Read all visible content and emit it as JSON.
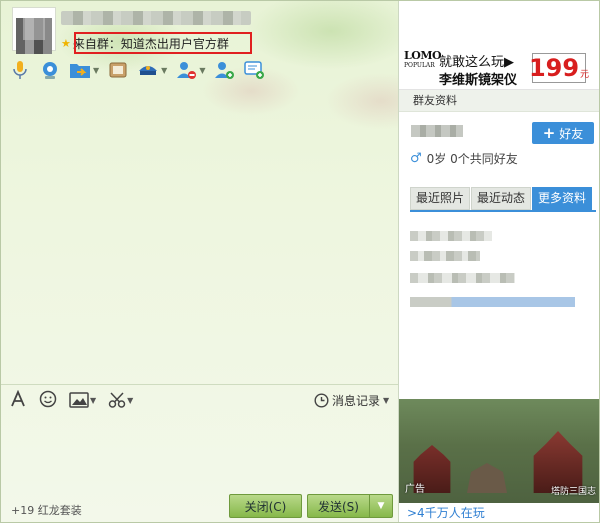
{
  "window": {
    "source_label": "来自群：知道杰出用户官方群",
    "controls": {
      "dropdown": "▾",
      "minimize": "–",
      "maximize": "□",
      "close": "✕"
    }
  },
  "toolbar": {
    "items": [
      {
        "name": "voice",
        "icon": "microphone-icon"
      },
      {
        "name": "video",
        "icon": "camera-icon"
      },
      {
        "name": "file",
        "icon": "folder-transfer-icon"
      },
      {
        "name": "screen",
        "icon": "screen-share-icon"
      },
      {
        "name": "app",
        "icon": "police-hat-icon"
      },
      {
        "name": "remove",
        "icon": "user-remove-icon"
      },
      {
        "name": "add",
        "icon": "user-add-icon"
      },
      {
        "name": "message",
        "icon": "message-add-icon"
      }
    ]
  },
  "input_tools": {
    "history_label": "消息记录",
    "icons": [
      "font-icon",
      "emoji-icon",
      "image-icon",
      "scissors-icon"
    ]
  },
  "footer": {
    "suit_label": "+19 红龙套装",
    "close_label": "关闭(C)",
    "send_label": "发送(S)"
  },
  "right_panel": {
    "ad": {
      "brand": "LOMO",
      "brand_sub": "POPULAR",
      "line1": "就敢这么玩▶",
      "line2": "李维斯镜架仪",
      "price": "199",
      "price_unit": "元"
    },
    "section_title": "群友资料",
    "add_friend_label": "好友",
    "age_text": "0岁  0个共同好友",
    "tabs": [
      "最近照片",
      "最近动态",
      "更多资料"
    ],
    "active_tab": "更多资料",
    "game_ad": {
      "tag": "广告",
      "logo": "塔防三国志",
      "players": ">4千万人在玩"
    }
  },
  "colors": {
    "accent_blue": "#3b8fd9",
    "send_green": "#86b84a",
    "highlight_red": "#e02020",
    "price_red": "#d81e1e"
  }
}
